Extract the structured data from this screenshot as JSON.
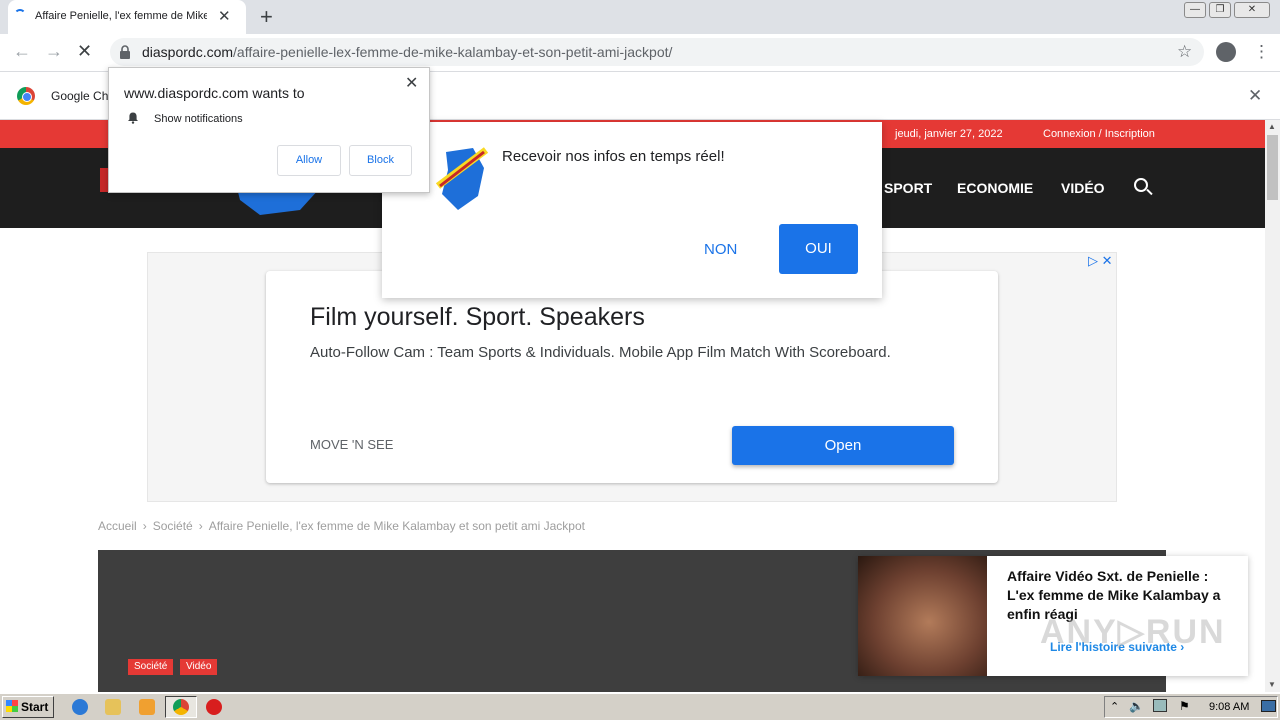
{
  "browser": {
    "tab_title": "Affaire Penielle, l'ex femme de Mike Kalambay et son petit ami Jackpot",
    "tab_close": "✕",
    "new_tab": "+",
    "url_domain": "diaspordc.com",
    "url_path": "/affaire-penielle-lex-femme-de-mike-kalambay-et-son-petit-ami-jackpot/",
    "infobar_text": "Google Ch",
    "infobar_close": "✕"
  },
  "permission_popup": {
    "title": "www.diaspordc.com wants to",
    "permission": "Show notifications",
    "allow_label": "Allow",
    "block_label": "Block",
    "close": "✕"
  },
  "push_dialog": {
    "message": "Recevoir nos infos en temps réel!",
    "non_label": "NON",
    "oui_label": "OUI"
  },
  "site": {
    "date": "jeudi, janvier 27, 2022",
    "login": "Connexion / Inscription",
    "nav": [
      "SPORT",
      "ECONOMIE",
      "VIDÉO"
    ]
  },
  "ad": {
    "title": "Film yourself. Sport. Speakers",
    "description": "Auto-Follow Cam : Team Sports & Individuals. Mobile App Film Match With Scoreboard.",
    "brand": "MOVE 'N SEE",
    "cta": "Open",
    "adchoices": "▷ ✕"
  },
  "breadcrumb": {
    "home": "Accueil",
    "category": "Société",
    "current": "Affaire Penielle, l'ex femme de Mike Kalambay et son petit ami Jackpot",
    "sep": "›"
  },
  "article": {
    "tags": [
      "Société",
      "Vidéo"
    ]
  },
  "recommendation": {
    "title": "Affaire Vidéo Sxt. de Penielle : L'ex femme de Mike Kalambay a enfin réagi",
    "link": "Lire l'histoire suivante ›"
  },
  "watermark": "ANY▷RUN",
  "taskbar": {
    "start_label": "Start",
    "clock": "9:08 AM"
  },
  "colors": {
    "site_red": "#e53935",
    "site_nav": "#1e1e1e",
    "button_blue": "#1a73e8"
  }
}
